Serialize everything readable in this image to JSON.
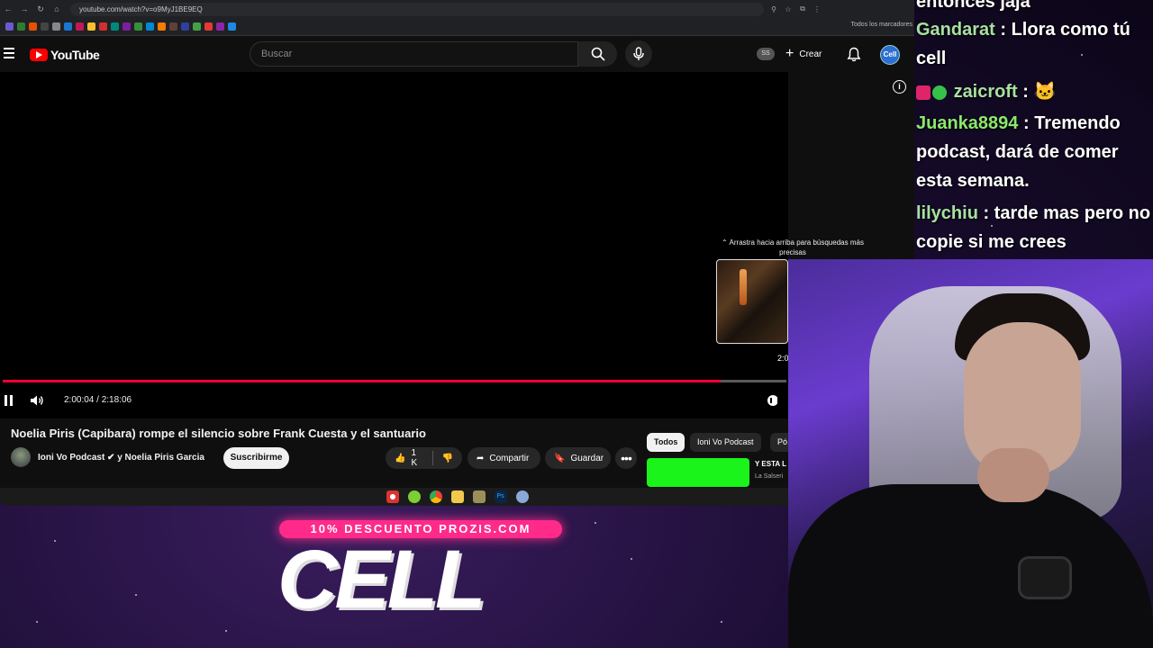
{
  "browser": {
    "url": "youtube.com/watch?v=o9MyJ1BE9EQ",
    "all_bookmarks": "Todos los marcadores"
  },
  "youtube": {
    "wordmark": "YouTube",
    "search_placeholder": "Buscar",
    "ss_badge": "SS",
    "create_label": "Crear",
    "avatar_text": "Cell"
  },
  "player": {
    "drag_hint": "Arrastra hacia arriba para búsquedas más precisas",
    "preview_time": "2:0",
    "time_readout": "2:00:04 / 2:18:06",
    "progress": 0.916
  },
  "video": {
    "title": "Noelia Piris (Capibara) rompe el silencio sobre Frank Cuesta y el santuario",
    "channel": "Ioni Vo Podcast ✔ y Noelia Piris Garcia",
    "subscribe_label": "Suscribirme",
    "likes": "1 K",
    "share_label": "Compartir",
    "save_label": "Guardar"
  },
  "chips": [
    "Todos",
    "Ioni Vo Podcast",
    "Pó"
  ],
  "related": {
    "title": "Y ESTA L",
    "channel": "La Salseri"
  },
  "overlay": {
    "promo": "10% DESCUENTO PROZIS.COM",
    "logo": "CELL"
  },
  "chat": [
    {
      "user": "",
      "text": "entonces jaja",
      "color": "#ffffff"
    },
    {
      "user": "Gandarat",
      "text": " : Llora como tú cell",
      "color": "#a8e0a0"
    },
    {
      "user": "zaicroft",
      "text": " : 🐱",
      "color": "#a8e0a0"
    },
    {
      "user": "Juanka8894",
      "text": " : Tremendo podcast, dará de comer esta semana.",
      "color": "#8be86b"
    },
    {
      "user": "lilychiu",
      "text": " : tarde mas pero no copie si me crees",
      "color": "#a8e0a0"
    }
  ],
  "colors": {
    "accent": "#ff0033",
    "promo": "#ff2a8a",
    "green_thumb": "#1af41a"
  }
}
